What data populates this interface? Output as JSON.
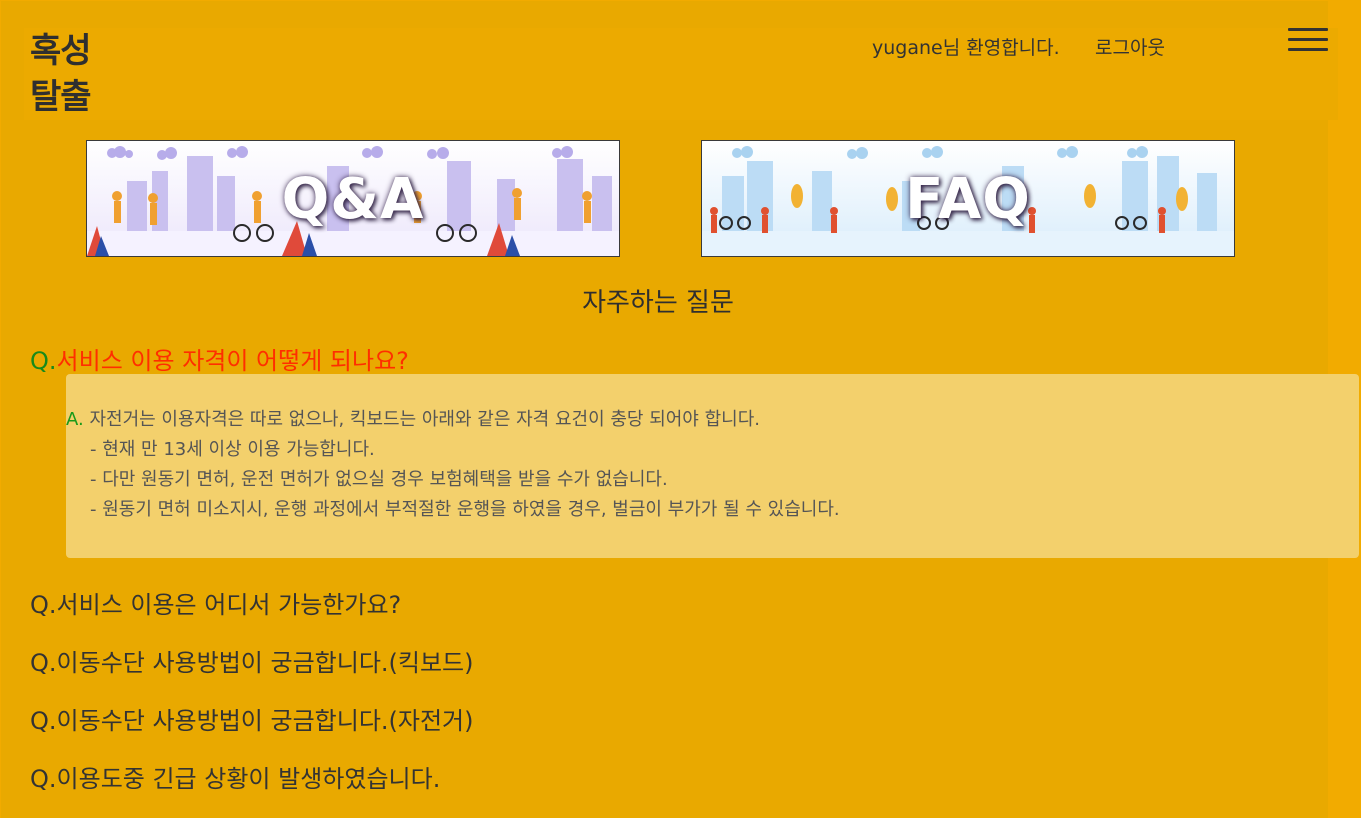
{
  "header": {
    "logo_line1": "혹성",
    "logo_line2": "탈출",
    "welcome": "yugane님 환영합니다.",
    "logout": "로그아웃",
    "menu_icon": "hamburger-menu-icon"
  },
  "banners": [
    {
      "label": "Q&A"
    },
    {
      "label": "FAQ"
    }
  ],
  "faq": {
    "heading": "자주하는 질문",
    "q_prefix": "Q.",
    "a_prefix": "A.",
    "active_question": "서비스 이용 자격이 어떻게 되나요?",
    "answer_lines": [
      "자전거는 이용자격은 따로 없으나, 킥보드는 아래와 같은 자격 요건이 충당 되어야 합니다.",
      "- 현재 만 13세 이상 이용 가능합니다.",
      "- 다만 원동기 면허, 운전 면허가 없으실 경우 보험혜택을 받을 수가 없습니다.",
      "- 원동기 면허 미소지시, 운행 과정에서 부적절한 운행을 하였을 경우, 벌금이 부가가 될 수 있습니다."
    ],
    "questions": [
      "서비스 이용은 어디서 가능한가요?",
      "이동수단 사용방법이 궁금합니다.(킥보드)",
      "이동수단 사용방법이 궁금합니다.(자전거)",
      "이용도중 긴급 상황이 발생하였습니다."
    ]
  },
  "colors": {
    "background": "#e9a900",
    "answer_box": "#f3d06c",
    "active_question_text": "#ff2e00",
    "q_marker_active": "#188a1a"
  }
}
